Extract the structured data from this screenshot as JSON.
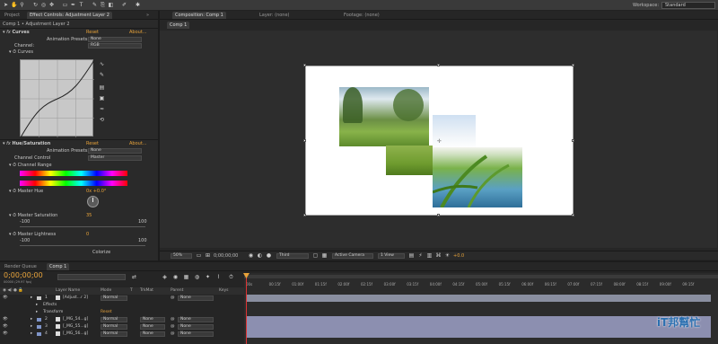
{
  "workspace": {
    "label": "Workspace:",
    "value": "Standard"
  },
  "left_panel": {
    "tabs": [
      "Project",
      "Effect Controls: Adjustment Layer 2",
      "»"
    ],
    "breadcrumb": "Comp 1 • Adjustment Layer 2",
    "curves": {
      "name": "Curves",
      "reset": "Reset",
      "about": "About...",
      "presets_label": "Animation Presets:",
      "presets_value": "None",
      "channel_label": "Channel:",
      "channel_value": "RGB",
      "curves_label": "Curves"
    },
    "hue": {
      "name": "Hue/Saturation",
      "reset": "Reset",
      "about": "About...",
      "presets_label": "Animation Presets:",
      "presets_value": "None",
      "channel_control_label": "Channel Control",
      "channel_control_value": "Master",
      "channel_range_label": "Channel Range",
      "master_hue_label": "Master Hue",
      "master_hue_value": "0x +0.0°",
      "master_sat_label": "Master Saturation",
      "master_sat_value": "35",
      "sat_min": "-100",
      "sat_max": "100",
      "master_light_label": "Master Lightness",
      "master_light_value": "0",
      "light_min": "-100",
      "light_max": "100",
      "colorize_label": "Colorize"
    }
  },
  "comp_panel": {
    "tabs": [
      "Composition: Comp 1",
      "Layer: (none)",
      "Footage: (none)"
    ],
    "subtab": "Comp 1",
    "footer": {
      "zoom": "50%",
      "timecode": "0;00;00;00",
      "quality": "Third",
      "camera": "Active Camera",
      "views": "1 View",
      "exposure": "+0.0"
    }
  },
  "timeline": {
    "tabs": [
      "Render Queue",
      "Comp 1"
    ],
    "timecode": "0;00;00;00",
    "timecode_sub": "00000 (29.97 fps)",
    "search_placeholder": "",
    "headers": {
      "layer_name": "Layer Name",
      "mode": "Mode",
      "t": "T",
      "trkmat": "TrkMat",
      "parent": "Parent",
      "keys": "Keys"
    },
    "ruler": [
      "00s",
      "00:15f",
      "01:00f",
      "01:15f",
      "02:00f",
      "02:15f",
      "03:00f",
      "03:15f",
      "04:00f",
      "04:15f",
      "05:00f",
      "05:15f",
      "06:00f",
      "06:15f",
      "07:00f",
      "07:15f",
      "08:00f",
      "08:15f",
      "09:00f",
      "09:15f"
    ],
    "layers": [
      {
        "num": "1",
        "name": "[Adjust...r 2]",
        "mode": "Normal",
        "trkmat": "",
        "parent": "None",
        "color": "#c9c9c9"
      },
      {
        "sub": "Effects"
      },
      {
        "sub": "Transform",
        "extra": "Reset"
      },
      {
        "num": "2",
        "name": "[_MG_54...g]",
        "mode": "Normal",
        "trkmat": "None",
        "parent": "None",
        "color": "#7f95c9"
      },
      {
        "num": "3",
        "name": "[_MG_55...g]",
        "mode": "Normal",
        "trkmat": "None",
        "parent": "None",
        "color": "#7f95c9"
      },
      {
        "num": "4",
        "name": "[_MG_56...g]",
        "mode": "Normal",
        "trkmat": "None",
        "parent": "None",
        "color": "#7f95c9"
      }
    ]
  },
  "watermark": {
    "text": "iT邦幫忙"
  },
  "colors": {
    "accent": "#e8a33a",
    "panel": "#2a2a2a",
    "track_adjust": "#8a8fa0",
    "track_image": "#8c8fb0"
  }
}
